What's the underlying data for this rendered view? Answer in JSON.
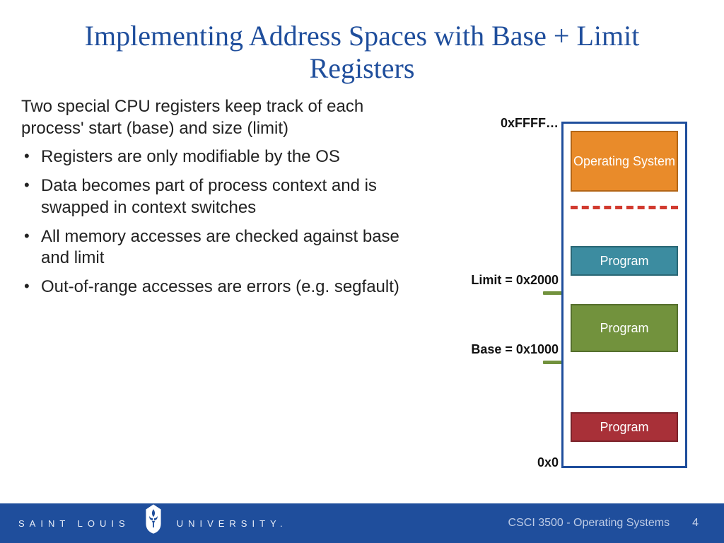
{
  "title": "Implementing Address Spaces with Base + Limit Registers",
  "lead": "Two special CPU registers keep track of each process' start (base) and size (limit)",
  "bullets": [
    "Registers are only modifiable by the OS",
    "Data becomes part of process context and is swapped in context switches",
    "All memory accesses are checked against base and limit",
    "Out-of-range accesses are errors (e.g. segfault)"
  ],
  "diagram": {
    "addr_top": "0xFFFF…",
    "addr_bot": "0x0",
    "limit_label": "Limit = 0x2000",
    "base_label": "Base = 0x1000",
    "blocks": {
      "os": "Operating System",
      "p1": "Program",
      "p2": "Program",
      "p3": "Program"
    }
  },
  "footer": {
    "brand_left": "SAINT LOUIS",
    "brand_right": "UNIVERSITY.",
    "course": "CSCI 3500 - Operating Systems",
    "page": "4"
  },
  "colors": {
    "accent": "#1f4e9c",
    "os_block": "#e98b2a",
    "prog_teal": "#3c8ca0",
    "prog_green": "#72923d",
    "prog_red": "#a83038",
    "dash": "#d13a2f"
  }
}
